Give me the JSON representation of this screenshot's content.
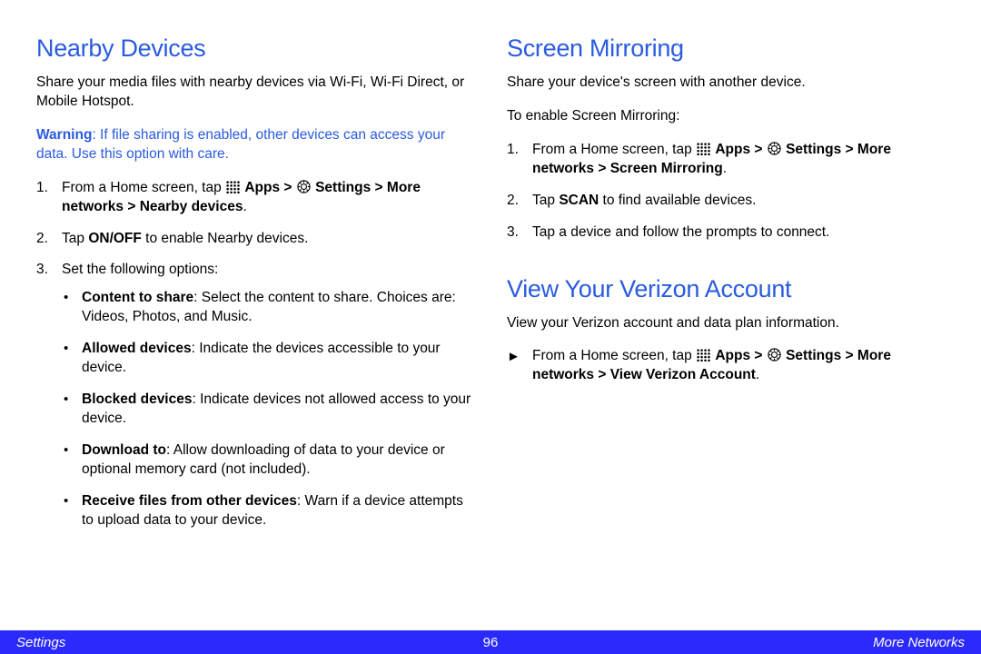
{
  "left": {
    "heading": "Nearby Devices",
    "intro": "Share your media files with nearby devices via Wi-Fi, Wi-Fi Direct, or Mobile Hotspot.",
    "warning_label": "Warning",
    "warning_text": ": If file sharing is enabled, other devices can access your data. Use this option with care.",
    "step1_pre": "From a Home screen, tap ",
    "step1_apps": "Apps > ",
    "step1_settings": "Settings > More networks > Nearby devices",
    "step1_post": ".",
    "step2_pre": "Tap ",
    "step2_b": "ON/OFF",
    "step2_post": " to enable Nearby devices.",
    "step3": "Set the following options:",
    "b1_b": "Content to share",
    "b1_t": ": Select the content to share. Choices are: Videos, Photos, and Music.",
    "b2_b": "Allowed devices",
    "b2_t": ": Indicate the devices accessible to your device.",
    "b3_b": "Blocked devices",
    "b3_t": ": Indicate devices not allowed access to your device.",
    "b4_b": "Download to",
    "b4_t": ": Allow downloading of data to your device or optional memory card (not included).",
    "b5_b": "Receive files from other devices",
    "b5_t": ": Warn if a device attempts to upload data to your device."
  },
  "right": {
    "heading1": "Screen Mirroring",
    "intro1a": "Share your device's screen with another device.",
    "intro1b": "To enable Screen Mirroring:",
    "s1_pre": "From a Home screen, tap ",
    "s1_apps": "Apps > ",
    "s1_settings": "Settings > More networks > Screen Mirroring",
    "s1_post": ".",
    "s2_pre": "Tap ",
    "s2_b": "SCAN",
    "s2_post": " to find available devices.",
    "s3": "Tap a device and follow the prompts to connect.",
    "heading2": "View Your Verizon Account",
    "intro2": "View your Verizon account and data plan information.",
    "arrow": "►",
    "a1_pre": "From a Home screen, tap ",
    "a1_apps": "Apps > ",
    "a1_settings": "Settings > More networks > View Verizon Account",
    "a1_post": "."
  },
  "footer": {
    "left": "Settings",
    "center": "96",
    "right": "More Networks"
  }
}
